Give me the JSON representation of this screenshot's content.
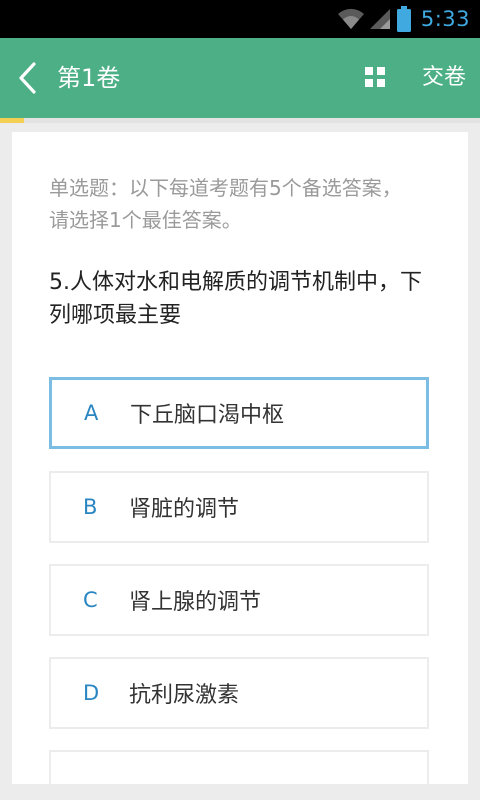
{
  "status_bar": {
    "time": "5:33",
    "icons": [
      "wifi-icon",
      "signal-icon",
      "battery-icon"
    ]
  },
  "app_bar": {
    "title": "第1卷",
    "submit_label": "交卷",
    "icons": [
      "back-arrow-icon",
      "grid-icon"
    ]
  },
  "progress": {
    "fraction": 0.05
  },
  "question": {
    "instruction": "单选题：以下每道考题有5个备选答案，请选择1个最佳答案。",
    "text": "5.人体对水和电解质的调节机制中，下列哪项最主要",
    "options": [
      {
        "letter": "A",
        "text": "下丘脑口渴中枢",
        "selected": true
      },
      {
        "letter": "B",
        "text": "肾脏的调节",
        "selected": false
      },
      {
        "letter": "C",
        "text": "肾上腺的调节",
        "selected": false
      },
      {
        "letter": "D",
        "text": "抗利尿激素",
        "selected": false
      }
    ]
  },
  "colors": {
    "app_bar": "#4caf85",
    "progress": "#f3cf54",
    "selected_border": "#7cbde4",
    "option_letter": "#2a86c2",
    "status_time": "#3fa9e0"
  }
}
